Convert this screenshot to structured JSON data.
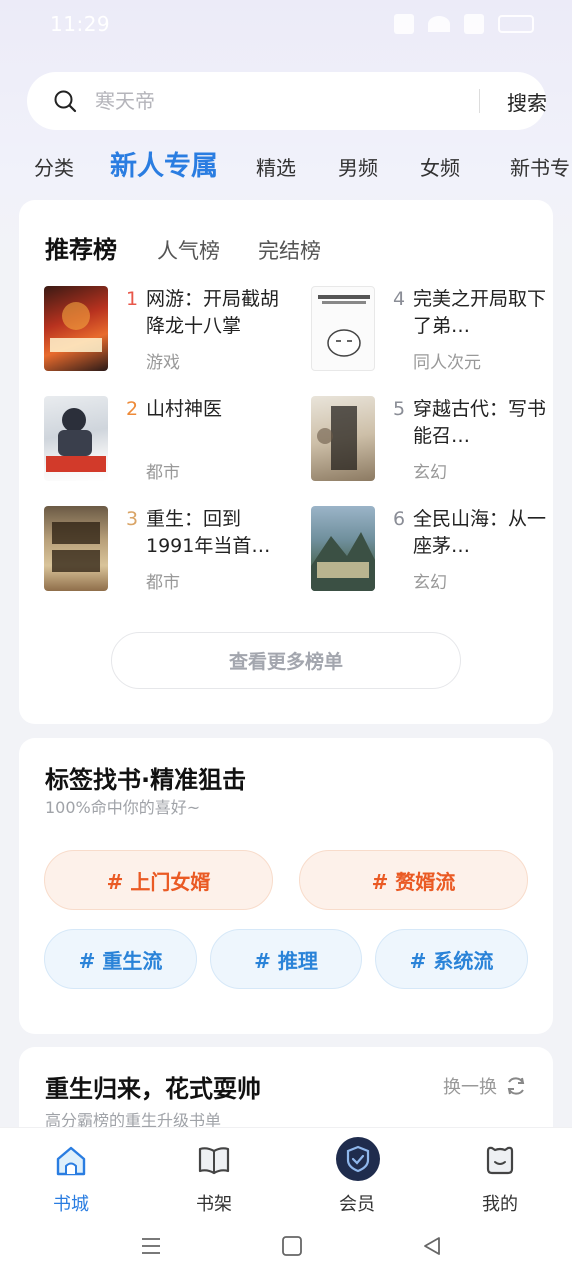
{
  "status_bar": {
    "time": "11:29"
  },
  "search": {
    "placeholder": "寒天帝",
    "button_label": "搜索"
  },
  "top_tabs": [
    {
      "label": "分类"
    },
    {
      "label": "新人专属",
      "active": true
    },
    {
      "label": "精选"
    },
    {
      "label": "男频"
    },
    {
      "label": "女频"
    },
    {
      "label": "新书专"
    }
  ],
  "ranking": {
    "tabs": [
      {
        "label": "推荐榜",
        "active": true
      },
      {
        "label": "人气榜"
      },
      {
        "label": "完结榜"
      }
    ],
    "books": [
      {
        "rank": "1",
        "title": "网游：开局截胡降龙十八掌",
        "genre": "游戏",
        "rank_color": "#e8574a"
      },
      {
        "rank": "2",
        "title": "山村神医",
        "genre": "都市",
        "rank_color": "#ee8a38"
      },
      {
        "rank": "3",
        "title": "重生：回到1991年当首…",
        "genre": "都市",
        "rank_color": "#d9a466"
      },
      {
        "rank": "4",
        "title": "完美之开局取下了弟…",
        "genre": "同人次元",
        "rank_color": "#8a8d96"
      },
      {
        "rank": "5",
        "title": "穿越古代：写书能召…",
        "genre": "玄幻",
        "rank_color": "#8a8d96"
      },
      {
        "rank": "6",
        "title": "全民山海：从一座茅…",
        "genre": "玄幻",
        "rank_color": "#8a8d96"
      }
    ],
    "more_button": "查看更多榜单"
  },
  "tags_section": {
    "title": "标签找书·精准狙击",
    "subtitle": "100%命中你的喜好~",
    "tags": [
      {
        "label": "# 上门女婿",
        "style": "orange"
      },
      {
        "label": "# 赘婿流",
        "style": "orange"
      },
      {
        "label": "# 重生流",
        "style": "blue"
      },
      {
        "label": "# 推理",
        "style": "blue"
      },
      {
        "label": "# 系统流",
        "style": "blue"
      }
    ]
  },
  "rebirth_section": {
    "title": "重生归来，花式耍帅",
    "subtitle": "高分霸榜的重生升级书单",
    "refresh_label": "换一换"
  },
  "bottom_nav": [
    {
      "label": "书城",
      "icon": "home-icon",
      "active": true
    },
    {
      "label": "书架",
      "icon": "bookshelf-icon"
    },
    {
      "label": "会员",
      "icon": "vip-shield-icon"
    },
    {
      "label": "我的",
      "icon": "profile-icon"
    }
  ],
  "colors": {
    "accent": "#2a7de1",
    "tag_orange": "#ea5a24",
    "tag_blue": "#2a83d8"
  }
}
